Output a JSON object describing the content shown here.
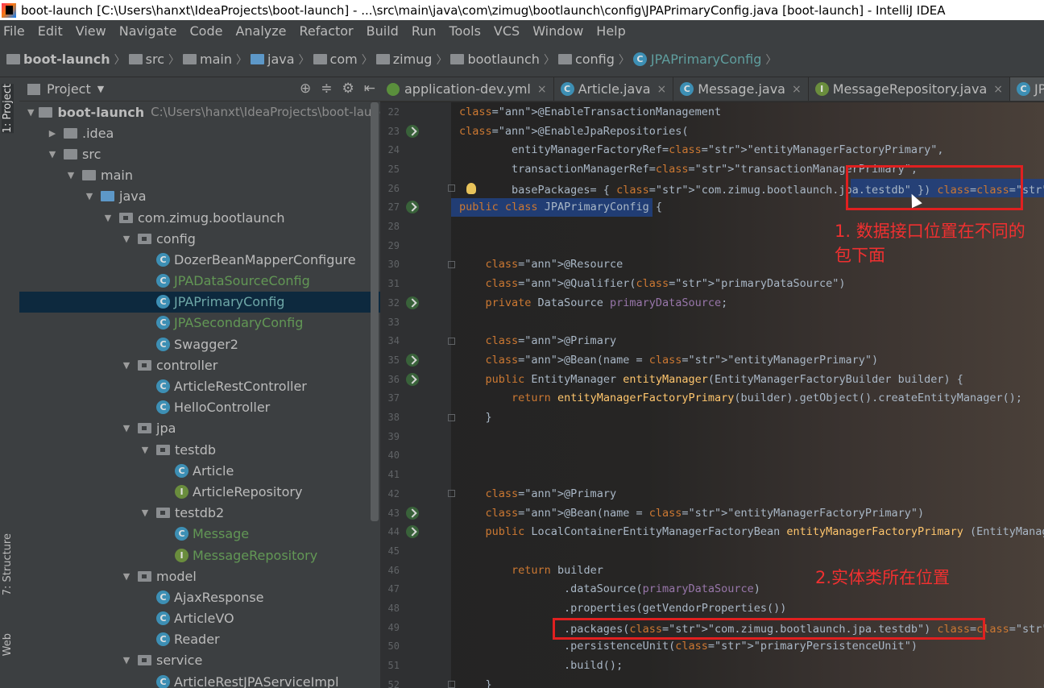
{
  "window": {
    "title": "boot-launch [C:\\Users\\hanxt\\IdeaProjects\\boot-launch] - ...\\src\\main\\java\\com\\zimug\\bootlaunch\\config\\JPAPrimaryConfig.java [boot-launch] - IntelliJ IDEA"
  },
  "menu": [
    "File",
    "Edit",
    "View",
    "Navigate",
    "Code",
    "Analyze",
    "Refactor",
    "Build",
    "Run",
    "Tools",
    "VCS",
    "Window",
    "Help"
  ],
  "breadcrumb": [
    "boot-launch",
    "src",
    "main",
    "java",
    "com",
    "zimug",
    "bootlaunch",
    "config",
    "JPAPrimaryConfig"
  ],
  "left_strip": {
    "project_tab": "1: Project",
    "structure_tab": "7: Structure",
    "web_tab": "Web"
  },
  "project_panel": {
    "title": "Project",
    "root_path": "C:\\Users\\hanxt\\IdeaProjects\\boot-launch",
    "tree": [
      {
        "label": "boot-launch",
        "depth": 0
      },
      {
        "label": ".idea",
        "depth": 1
      },
      {
        "label": "src",
        "depth": 1
      },
      {
        "label": "main",
        "depth": 2
      },
      {
        "label": "java",
        "depth": 3
      },
      {
        "label": "com.zimug.bootlaunch",
        "depth": 4
      },
      {
        "label": "config",
        "depth": 5
      },
      {
        "label": "DozerBeanMapperConfigure",
        "depth": 6
      },
      {
        "label": "JPADataSourceConfig",
        "depth": 6
      },
      {
        "label": "JPAPrimaryConfig",
        "depth": 6
      },
      {
        "label": "JPASecondaryConfig",
        "depth": 6
      },
      {
        "label": "Swagger2",
        "depth": 6
      },
      {
        "label": "controller",
        "depth": 5
      },
      {
        "label": "ArticleRestController",
        "depth": 6
      },
      {
        "label": "HelloController",
        "depth": 6
      },
      {
        "label": "jpa",
        "depth": 5
      },
      {
        "label": "testdb",
        "depth": 6
      },
      {
        "label": "Article",
        "depth": 7
      },
      {
        "label": "ArticleRepository",
        "depth": 7
      },
      {
        "label": "testdb2",
        "depth": 6
      },
      {
        "label": "Message",
        "depth": 7
      },
      {
        "label": "MessageRepository",
        "depth": 7
      },
      {
        "label": "model",
        "depth": 5
      },
      {
        "label": "AjaxResponse",
        "depth": 6
      },
      {
        "label": "ArticleVO",
        "depth": 6
      },
      {
        "label": "Reader",
        "depth": 6
      },
      {
        "label": "service",
        "depth": 5
      },
      {
        "label": "ArticleRestJPAServiceImpl",
        "depth": 6
      }
    ]
  },
  "tabs": [
    "application-dev.yml",
    "Article.java",
    "Message.java",
    "MessageRepository.java",
    "JPADa"
  ],
  "tab_close_glyph": "×",
  "code": [
    {
      "n": "22",
      "t": "@EnableTransactionManagement"
    },
    {
      "n": "23",
      "t": "@EnableJpaRepositories("
    },
    {
      "n": "24",
      "t": "        entityManagerFactoryRef=\"entityManagerFactoryPrimary\","
    },
    {
      "n": "25",
      "t": "        transactionManagerRef=\"transactionManagerPrimary\","
    },
    {
      "n": "26",
      "t": "        basePackages= { \"com.zimug.bootlaunch.jpa.testdb\" }) //设置Repository所在位置"
    },
    {
      "n": "27",
      "t": "public class JPAPrimaryConfig {"
    },
    {
      "n": "28",
      "t": ""
    },
    {
      "n": "29",
      "t": ""
    },
    {
      "n": "30",
      "t": "    @Resource"
    },
    {
      "n": "31",
      "t": "    @Qualifier(\"primaryDataSource\")"
    },
    {
      "n": "32",
      "t": "    private DataSource primaryDataSource;"
    },
    {
      "n": "33",
      "t": ""
    },
    {
      "n": "34",
      "t": "    @Primary"
    },
    {
      "n": "35",
      "t": "    @Bean(name = \"entityManagerPrimary\")"
    },
    {
      "n": "36",
      "t": "    public EntityManager entityManager(EntityManagerFactoryBuilder builder) {"
    },
    {
      "n": "37",
      "t": "        return entityManagerFactoryPrimary(builder).getObject().createEntityManager();"
    },
    {
      "n": "38",
      "t": "    }"
    },
    {
      "n": "39",
      "t": ""
    },
    {
      "n": "40",
      "t": ""
    },
    {
      "n": "41",
      "t": ""
    },
    {
      "n": "42",
      "t": "    @Primary"
    },
    {
      "n": "43",
      "t": "    @Bean(name = \"entityManagerFactoryPrimary\")"
    },
    {
      "n": "44",
      "t": "    public LocalContainerEntityManagerFactoryBean entityManagerFactoryPrimary (EntityManage"
    },
    {
      "n": "45",
      "t": ""
    },
    {
      "n": "46",
      "t": "        return builder"
    },
    {
      "n": "47",
      "t": "                .dataSource(primaryDataSource)"
    },
    {
      "n": "48",
      "t": "                .properties(getVendorProperties())"
    },
    {
      "n": "49",
      "t": "                .packages(\"com.zimug.bootlaunch.jpa.testdb\") //设置实体类所在位置"
    },
    {
      "n": "50",
      "t": "                .persistenceUnit(\"primaryPersistenceUnit\")"
    },
    {
      "n": "51",
      "t": "                .build();"
    },
    {
      "n": "52",
      "t": "    }"
    }
  ],
  "annotations": {
    "note1": "1. 数据接口位置在不同的包下面",
    "note2": "2.实体类所在位置"
  }
}
